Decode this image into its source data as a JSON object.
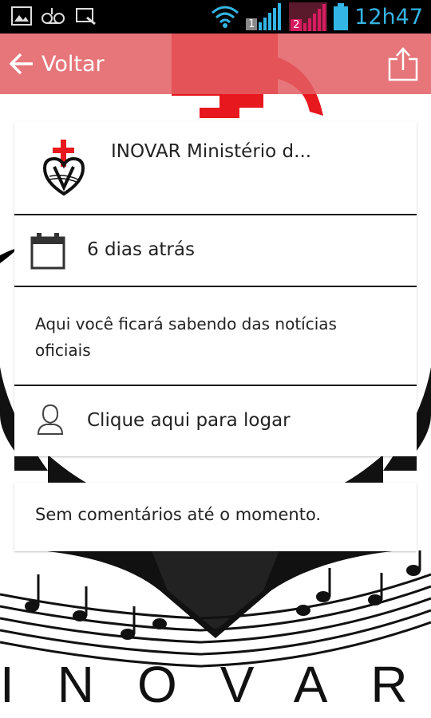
{
  "status_bar": {
    "time": "12h47",
    "sim1_label": "1",
    "sim2_label": "2"
  },
  "action_bar": {
    "back_label": "Voltar"
  },
  "post": {
    "author_name": "INOVAR Ministério d...",
    "date": "6 dias atrás",
    "body": "Aqui você ficará sabendo das notícias oficiais",
    "login_prompt": "Clique aqui para logar"
  },
  "comments": {
    "empty_text": "Sem comentários até o momento."
  },
  "background": {
    "brand_text": "INOVAR"
  },
  "colors": {
    "action_bar": "#e25e63",
    "status_accent": "#33b5e5",
    "sim2_accent": "#d81b60"
  }
}
